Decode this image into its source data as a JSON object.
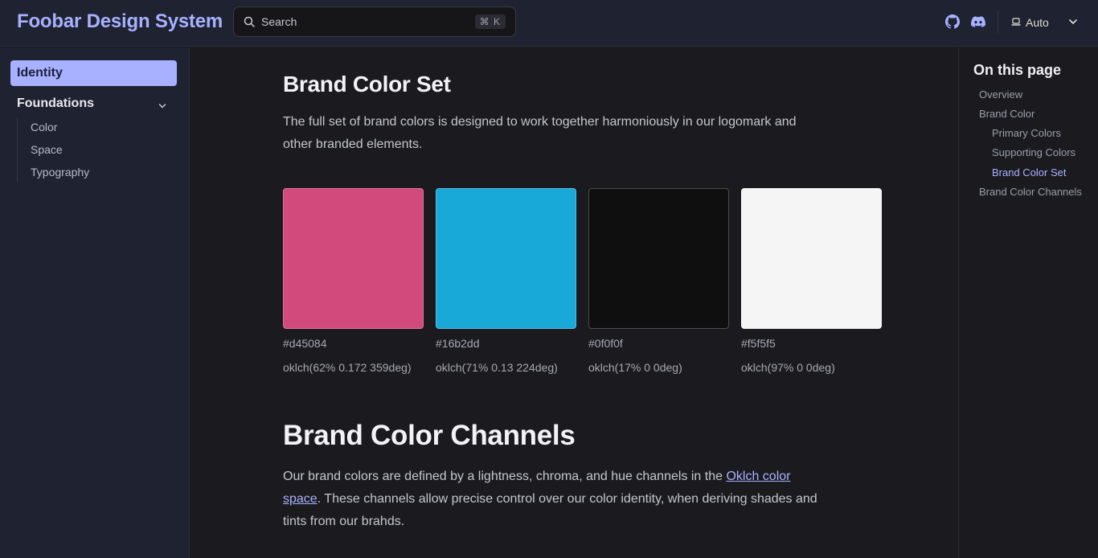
{
  "header": {
    "site_title": "Foobar Design System",
    "search": {
      "label": "Search",
      "shortcut": "⌘ K"
    },
    "theme": {
      "label": "Auto"
    },
    "icons": [
      "github-icon",
      "discord-icon",
      "laptop-icon",
      "chevron-down-icon"
    ]
  },
  "sidebar": {
    "active_item": "Identity",
    "group": {
      "label": "Foundations",
      "expanded": true
    },
    "items": [
      "Color",
      "Space",
      "Typography"
    ]
  },
  "main": {
    "brand_color_set": {
      "heading": "Brand Color Set",
      "description": "The full set of brand colors is designed to work together harmoniously in our logomark and other branded elements.",
      "swatches": [
        {
          "hex": "#d45084",
          "oklch": "oklch(62% 0.172 359deg)",
          "color": "#d24a7c"
        },
        {
          "hex": "#16b2dd",
          "oklch": "oklch(71% 0.13 224deg)",
          "color": "#18a9d8"
        },
        {
          "hex": "#0f0f0f",
          "oklch": "oklch(17% 0 0deg)",
          "color": "#0f0f0f"
        },
        {
          "hex": "#f5f5f5",
          "oklch": "oklch(97% 0 0deg)",
          "color": "#f5f5f5"
        }
      ]
    },
    "brand_color_channels": {
      "heading": "Brand Color Channels",
      "text_before": "Our brand colors are defined by a lightness, chroma, and hue channels in the ",
      "link_text": "Oklch color space",
      "text_after": ". These channels allow precise control over our color identity, when deriving shades and tints from our brahds."
    }
  },
  "outline": {
    "title": "On this page",
    "links": [
      {
        "label": "Overview",
        "level": 1,
        "active": false
      },
      {
        "label": "Brand Color",
        "level": 1,
        "active": false
      },
      {
        "label": "Primary Colors",
        "level": 2,
        "active": false
      },
      {
        "label": "Supporting Colors",
        "level": 2,
        "active": false
      },
      {
        "label": "Brand Color Set",
        "level": 2,
        "active": true
      },
      {
        "label": "Brand Color Channels",
        "level": 1,
        "active": false
      }
    ]
  }
}
